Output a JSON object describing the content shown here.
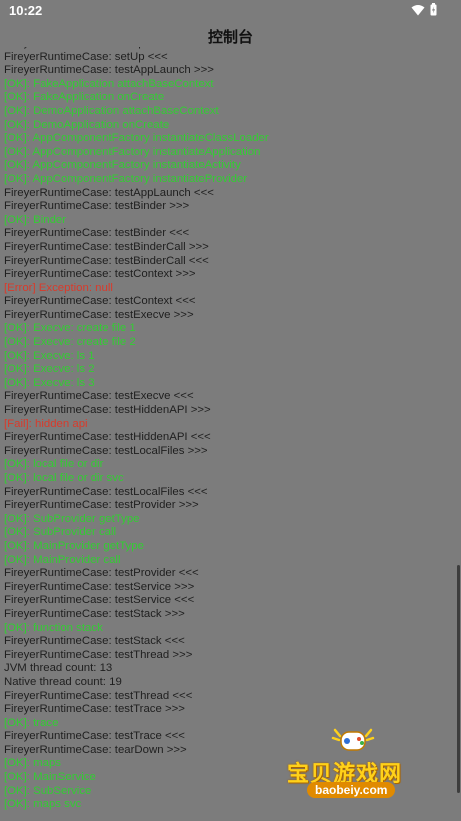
{
  "status_bar": {
    "time": "10:22"
  },
  "title_bar": {
    "title": "控制台"
  },
  "log": {
    "lines": [
      {
        "text": "FireyerRuntimeCase: setUp >>>",
        "level": "info"
      },
      {
        "text": "FireyerRuntimeCase: setUp <<<",
        "level": "info"
      },
      {
        "text": "FireyerRuntimeCase: testAppLaunch >>>",
        "level": "info"
      },
      {
        "text": "[OK]: FakeApplication attachBaseContext",
        "level": "ok"
      },
      {
        "text": "[OK]: FakeApplication onCreate",
        "level": "ok"
      },
      {
        "text": "[OK]: DemoApplication attachBaseContext",
        "level": "ok"
      },
      {
        "text": "[OK]: DemoApplication onCreate",
        "level": "ok"
      },
      {
        "text": "[OK]: AppComponentFactory instantiateClassLoader",
        "level": "ok"
      },
      {
        "text": "[OK]: AppComponentFactory instantiateApplication",
        "level": "ok"
      },
      {
        "text": "[OK]: AppComponentFactory instantiateActivity",
        "level": "ok"
      },
      {
        "text": "[OK]: AppComponentFactory instantiateProvider",
        "level": "ok"
      },
      {
        "text": "FireyerRuntimeCase: testAppLaunch <<<",
        "level": "info"
      },
      {
        "text": "FireyerRuntimeCase: testBinder >>>",
        "level": "info"
      },
      {
        "text": "[OK]: Binder",
        "level": "ok"
      },
      {
        "text": "FireyerRuntimeCase: testBinder <<<",
        "level": "info"
      },
      {
        "text": "FireyerRuntimeCase: testBinderCall >>>",
        "level": "info"
      },
      {
        "text": "FireyerRuntimeCase: testBinderCall <<<",
        "level": "info"
      },
      {
        "text": "FireyerRuntimeCase: testContext >>>",
        "level": "info"
      },
      {
        "text": "[Error] Exception: null",
        "level": "error"
      },
      {
        "text": "FireyerRuntimeCase: testContext <<<",
        "level": "info"
      },
      {
        "text": "FireyerRuntimeCase: testExecve >>>",
        "level": "info"
      },
      {
        "text": "[OK]: Execve: create file 1",
        "level": "ok"
      },
      {
        "text": "[OK]: Execve: create file 2",
        "level": "ok"
      },
      {
        "text": "[OK]: Execve: ls 1",
        "level": "ok"
      },
      {
        "text": "[OK]: Execve: ls 2",
        "level": "ok"
      },
      {
        "text": "[OK]: Execve: ls 3",
        "level": "ok"
      },
      {
        "text": "FireyerRuntimeCase: testExecve <<<",
        "level": "info"
      },
      {
        "text": "FireyerRuntimeCase: testHiddenAPI >>>",
        "level": "info"
      },
      {
        "text": "[Fail]: hidden api",
        "level": "error"
      },
      {
        "text": "FireyerRuntimeCase: testHiddenAPI <<<",
        "level": "info"
      },
      {
        "text": "FireyerRuntimeCase: testLocalFiles >>>",
        "level": "info"
      },
      {
        "text": "[OK]: local file or dir",
        "level": "ok"
      },
      {
        "text": "[OK]: local file or dir svc",
        "level": "ok"
      },
      {
        "text": "FireyerRuntimeCase: testLocalFiles <<<",
        "level": "info"
      },
      {
        "text": "FireyerRuntimeCase: testProvider >>>",
        "level": "info"
      },
      {
        "text": "[OK]: SubProvider getType",
        "level": "ok"
      },
      {
        "text": "[OK]: SubProvider call",
        "level": "ok"
      },
      {
        "text": "[OK]: MainProvider getType",
        "level": "ok"
      },
      {
        "text": "[OK]: MainProvider call",
        "level": "ok"
      },
      {
        "text": "FireyerRuntimeCase: testProvider <<<",
        "level": "info"
      },
      {
        "text": "FireyerRuntimeCase: testService >>>",
        "level": "info"
      },
      {
        "text": "FireyerRuntimeCase: testService <<<",
        "level": "info"
      },
      {
        "text": "FireyerRuntimeCase: testStack >>>",
        "level": "info"
      },
      {
        "text": "[OK]: function stack",
        "level": "ok"
      },
      {
        "text": "FireyerRuntimeCase: testStack <<<",
        "level": "info"
      },
      {
        "text": "FireyerRuntimeCase: testThread >>>",
        "level": "info"
      },
      {
        "text": "JVM thread count: 13",
        "level": "info"
      },
      {
        "text": "Native thread count: 19",
        "level": "info"
      },
      {
        "text": "FireyerRuntimeCase: testThread <<<",
        "level": "info"
      },
      {
        "text": "FireyerRuntimeCase: testTrace >>>",
        "level": "info"
      },
      {
        "text": "[OK]: trace",
        "level": "ok"
      },
      {
        "text": "FireyerRuntimeCase: testTrace <<<",
        "level": "info"
      },
      {
        "text": "FireyerRuntimeCase: tearDown >>>",
        "level": "info"
      },
      {
        "text": "[OK]: maps",
        "level": "ok"
      },
      {
        "text": "[OK]: MainService",
        "level": "ok"
      },
      {
        "text": "[OK]: SubService",
        "level": "ok"
      },
      {
        "text": "[OK]: maps svc",
        "level": "ok"
      }
    ]
  },
  "watermark": {
    "title": "宝贝游戏网",
    "url": "baobeiy.com"
  },
  "colors": {
    "background": "#7c7c7c",
    "info_text": "#1f1f1f",
    "ok_text": "#33cc33",
    "error_text": "#d93a2b"
  },
  "icons": {
    "wifi": "wifi-icon",
    "battery": "battery-icon",
    "watermark_logo": "gamepad-icon"
  }
}
